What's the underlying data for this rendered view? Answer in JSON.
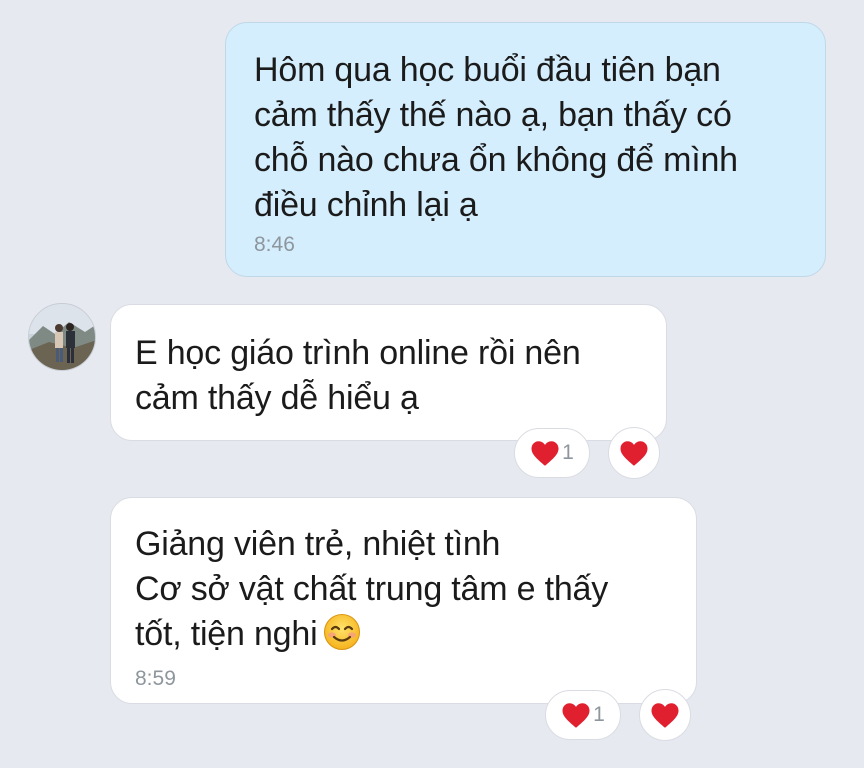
{
  "messages": [
    {
      "direction": "outgoing",
      "text": "Hôm qua học buổi đầu tiên bạn\ncảm thấy thế nào ạ, bạn thấy có\nchỗ nào chưa ổn không để mình\nđiều chỉnh lại ạ",
      "time": "8:46"
    },
    {
      "direction": "incoming",
      "text": "E học giáo trình online rồi nên\ncảm thấy dễ hiểu ạ",
      "reaction": {
        "icon": "heart-icon",
        "count": "1"
      }
    },
    {
      "direction": "incoming",
      "text": "Giảng viên trẻ, nhiệt tình\nCơ sở vật chất trung tâm e thấy\ntốt, tiện nghi",
      "emoji": "smiling-face-icon",
      "time": "8:59",
      "reaction": {
        "icon": "heart-icon",
        "count": "1"
      }
    }
  ],
  "colors": {
    "background": "#e6e9f0",
    "outgoing_bubble": "#d5eefd",
    "incoming_bubble": "#ffffff",
    "heart": "#e0202f",
    "timestamp": "#8e969d"
  }
}
